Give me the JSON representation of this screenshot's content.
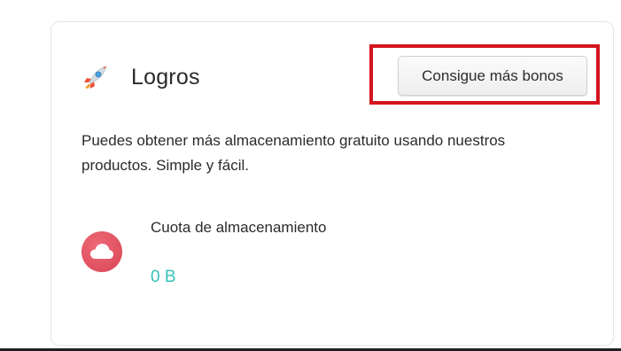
{
  "card": {
    "title": "Logros",
    "icon": "rocket-icon",
    "bonus_button_label": "Consigue más bonos",
    "description": "Puedes obtener más almacenamiento gratuito usando nuestros productos. Simple y fácil."
  },
  "quota": {
    "icon": "cloud-icon",
    "label": "Cuota de almacenamiento",
    "value": "0 B"
  },
  "colors": {
    "highlight_border": "#d4151f",
    "quota_icon_bg": "#e05461",
    "quota_value": "#33c2b8",
    "text": "#2b2b2b"
  }
}
